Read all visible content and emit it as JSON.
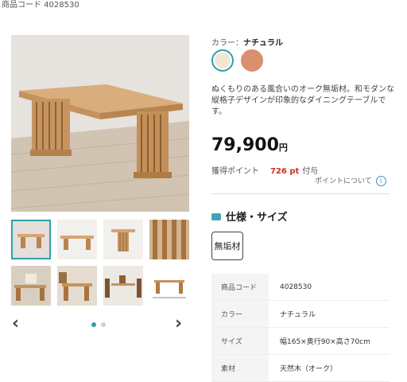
{
  "header": {
    "product_code_line": "商品コード 4028530"
  },
  "color": {
    "label": "カラー：",
    "selected": "ナチュラル",
    "swatches": [
      {
        "name": "natural",
        "hex": "#f3e7d4",
        "selected": true
      },
      {
        "name": "brown",
        "hex": "#d9906c",
        "selected": false
      }
    ]
  },
  "description": "ぬくもりのある風合いのオーク無垢材。和モダンな縦格子デザインが印象的なダイニングテーブルです。",
  "price": {
    "amount": "79,900",
    "unit": "円"
  },
  "points": {
    "label": "獲得ポイント",
    "value": "726 pt",
    "suffix": "付与",
    "about_link": "ポイントについて",
    "about_icon": "info-icon"
  },
  "spec_section": {
    "title": "仕様・サイズ",
    "badge": "無垢材",
    "rows": [
      {
        "key": "商品コード",
        "value": "4028530"
      },
      {
        "key": "カラー",
        "value": "ナチュラル"
      },
      {
        "key": "サイズ",
        "value": "幅165×奥行90×高さ70cm"
      },
      {
        "key": "素材",
        "value": "天然木（オーク）"
      }
    ]
  },
  "gallery": {
    "prev_icon": "chevron-left-icon",
    "next_icon": "chevron-right-icon",
    "prev_label": "‹",
    "next_label": "›",
    "page_dots": 2,
    "active_dot": 0,
    "accent": "#2f9fa8"
  }
}
